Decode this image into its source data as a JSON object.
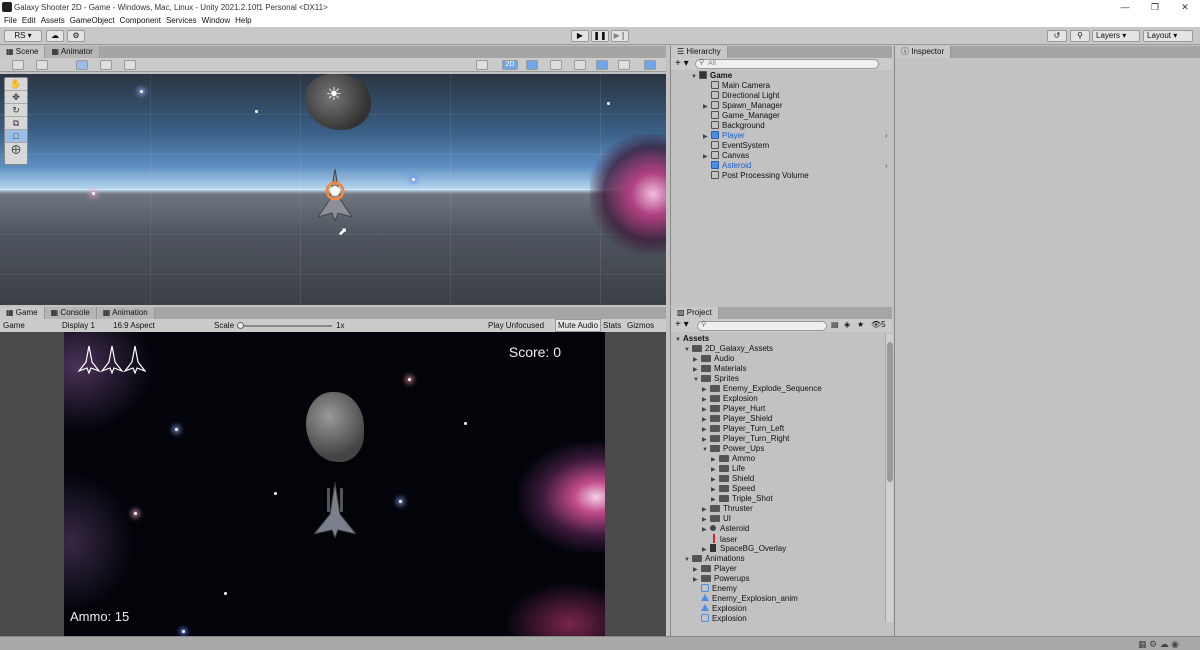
{
  "window": {
    "title": "Galaxy Shooter 2D - Game - Windows, Mac, Linux - Unity 2021.2.10f1 Personal <DX11>",
    "minimize": "—",
    "restore": "❐",
    "close": "✕"
  },
  "menu": [
    "File",
    "Edit",
    "Assets",
    "GameObject",
    "Component",
    "Services",
    "Window",
    "Help"
  ],
  "toolbar": {
    "account": "RS ▾",
    "layers": "Layers",
    "layout": "Layout"
  },
  "scene_panel": {
    "tabs": [
      "Scene",
      "Animator"
    ],
    "toggle_2d": "2D"
  },
  "game_panel": {
    "tabs": [
      "Game",
      "Console",
      "Animation"
    ],
    "display_mode": "Game",
    "display": "Display 1",
    "aspect": "16:9 Aspect",
    "scale_label": "Scale",
    "scale_value": "1x",
    "play_mode": "Play Unfocused",
    "mute": "Mute Audio",
    "stats": "Stats",
    "gizmos": "Gizmos"
  },
  "game": {
    "score": "Score: 0",
    "ammo": "Ammo: 15",
    "lives": 3
  },
  "hierarchy": {
    "tab": "Hierarchy",
    "search_placeholder": "All",
    "scene_name": "Game",
    "items": [
      {
        "label": "Main Camera",
        "expandable": false,
        "highlight": false
      },
      {
        "label": "Directional Light",
        "expandable": false,
        "highlight": false
      },
      {
        "label": "Spawn_Manager",
        "expandable": true,
        "highlight": false
      },
      {
        "label": "Game_Manager",
        "expandable": false,
        "highlight": false
      },
      {
        "label": "Background",
        "expandable": false,
        "highlight": false
      },
      {
        "label": "Player",
        "expandable": true,
        "highlight": true
      },
      {
        "label": "EventSystem",
        "expandable": false,
        "highlight": false
      },
      {
        "label": "Canvas",
        "expandable": true,
        "highlight": false
      },
      {
        "label": "Asteroid",
        "expandable": false,
        "highlight": true
      },
      {
        "label": "Post Processing Volume",
        "expandable": false,
        "highlight": false
      }
    ]
  },
  "inspector": {
    "tab": "Inspector"
  },
  "project": {
    "tab": "Project",
    "hidden_count": "5",
    "items": [
      {
        "label": "Assets",
        "depth": 0,
        "type": "root",
        "arrow": "down",
        "bold": true
      },
      {
        "label": "2D_Galaxy_Assets",
        "depth": 1,
        "type": "folder",
        "arrow": "down"
      },
      {
        "label": "Audio",
        "depth": 2,
        "type": "folder",
        "arrow": "right"
      },
      {
        "label": "Materials",
        "depth": 2,
        "type": "folder",
        "arrow": "right"
      },
      {
        "label": "Sprites",
        "depth": 2,
        "type": "folder",
        "arrow": "down"
      },
      {
        "label": "Enemy_Explode_Sequence",
        "depth": 3,
        "type": "folder",
        "arrow": "right"
      },
      {
        "label": "Explosion",
        "depth": 3,
        "type": "folder",
        "arrow": "right"
      },
      {
        "label": "Player_Hurt",
        "depth": 3,
        "type": "folder",
        "arrow": "right"
      },
      {
        "label": "Player_Shield",
        "depth": 3,
        "type": "folder",
        "arrow": "right"
      },
      {
        "label": "Player_Turn_Left",
        "depth": 3,
        "type": "folder",
        "arrow": "right"
      },
      {
        "label": "Player_Turn_Right",
        "depth": 3,
        "type": "folder",
        "arrow": "right"
      },
      {
        "label": "Power_Ups",
        "depth": 3,
        "type": "folder",
        "arrow": "down"
      },
      {
        "label": "Ammo",
        "depth": 4,
        "type": "folder",
        "arrow": "right"
      },
      {
        "label": "Life",
        "depth": 4,
        "type": "folder",
        "arrow": "right"
      },
      {
        "label": "Shield",
        "depth": 4,
        "type": "folder",
        "arrow": "right"
      },
      {
        "label": "Speed",
        "depth": 4,
        "type": "folder",
        "arrow": "right"
      },
      {
        "label": "Triple_Shot",
        "depth": 4,
        "type": "folder",
        "arrow": "right"
      },
      {
        "label": "Thruster",
        "depth": 3,
        "type": "folder",
        "arrow": "right"
      },
      {
        "label": "UI",
        "depth": 3,
        "type": "folder",
        "arrow": "right"
      },
      {
        "label": "Asteroid",
        "depth": 3,
        "type": "sprite",
        "arrow": "right"
      },
      {
        "label": "laser",
        "depth": 3,
        "type": "laser",
        "arrow": "none"
      },
      {
        "label": "SpaceBG_Overlay",
        "depth": 3,
        "type": "image",
        "arrow": "right"
      },
      {
        "label": "Animations",
        "depth": 1,
        "type": "folder",
        "arrow": "down"
      },
      {
        "label": "Player",
        "depth": 2,
        "type": "folder",
        "arrow": "right"
      },
      {
        "label": "Powerups",
        "depth": 2,
        "type": "folder",
        "arrow": "right"
      },
      {
        "label": "Enemy",
        "depth": 2,
        "type": "controller",
        "arrow": "none"
      },
      {
        "label": "Enemy_Explosion_anim",
        "depth": 2,
        "type": "clip",
        "arrow": "none"
      },
      {
        "label": "Explosion",
        "depth": 2,
        "type": "clip",
        "arrow": "none"
      },
      {
        "label": "Explosion",
        "depth": 2,
        "type": "controller",
        "arrow": "none"
      }
    ]
  },
  "colors": {
    "accent": "#4a8ee8",
    "highlight_text": "#1a5fd0",
    "editor_bg": "#c2c2c2"
  }
}
